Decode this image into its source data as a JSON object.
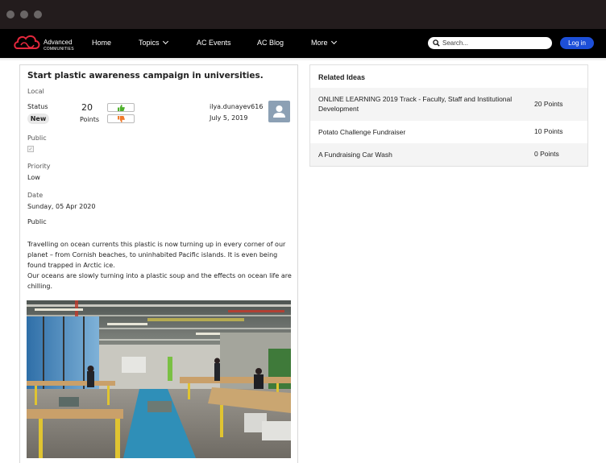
{
  "nav": {
    "logo": {
      "line1": "Advanced",
      "line2": "COMMUNITIES"
    },
    "items": [
      {
        "label": "Home"
      },
      {
        "label": "Topics"
      },
      {
        "label": "AC Events"
      },
      {
        "label": "AC Blog"
      },
      {
        "label": "More"
      }
    ],
    "search_placeholder": "Search...",
    "login_label": "Log in"
  },
  "idea": {
    "title": "Start plastic awareness campaign in universities.",
    "zone": "Local",
    "status_label": "Status",
    "status": "New",
    "points_value": "20",
    "points_label": "Points",
    "author": "ilya.dunayev616",
    "date": "July 5, 2019",
    "public_label": "Public",
    "public_checked": true,
    "priority_label": "Priority",
    "priority": "Low",
    "date_label": "Date",
    "date_value": "Sunday, 05 Apr 2020",
    "visibility": "Public",
    "body_p1": "Travelling on ocean currents this plastic is now turning up in every corner of our planet – from Cornish beaches, to uninhabited Pacific islands. It is even being found trapped in Arctic ice.",
    "body_p2": "Our oceans are slowly turning into a plastic soup and the effects on ocean life are chilling."
  },
  "related": {
    "heading": "Related Ideas",
    "items": [
      {
        "title": "ONLINE LEARNING 2019 Track - Faculty, Staff and Institutional Development",
        "points": "20 Points"
      },
      {
        "title": "Potato Challenge Fundraiser",
        "points": "10 Points"
      },
      {
        "title": "A Fundraising Car Wash",
        "points": "0 Points"
      }
    ]
  },
  "colors": {
    "nav_bg": "#000000",
    "chrome_bg": "#231c1d",
    "login_bg": "#1d4fd8",
    "logo_red": "#e5283d",
    "upvote_green": "#4caf2a",
    "downvote_orange": "#f07a2b",
    "row_alt": "#f4f4f4"
  },
  "icons": [
    "search-icon",
    "thumbs-up-icon",
    "thumbs-down-icon",
    "user-avatar-icon",
    "chevron-down-icon",
    "logo-icon"
  ]
}
